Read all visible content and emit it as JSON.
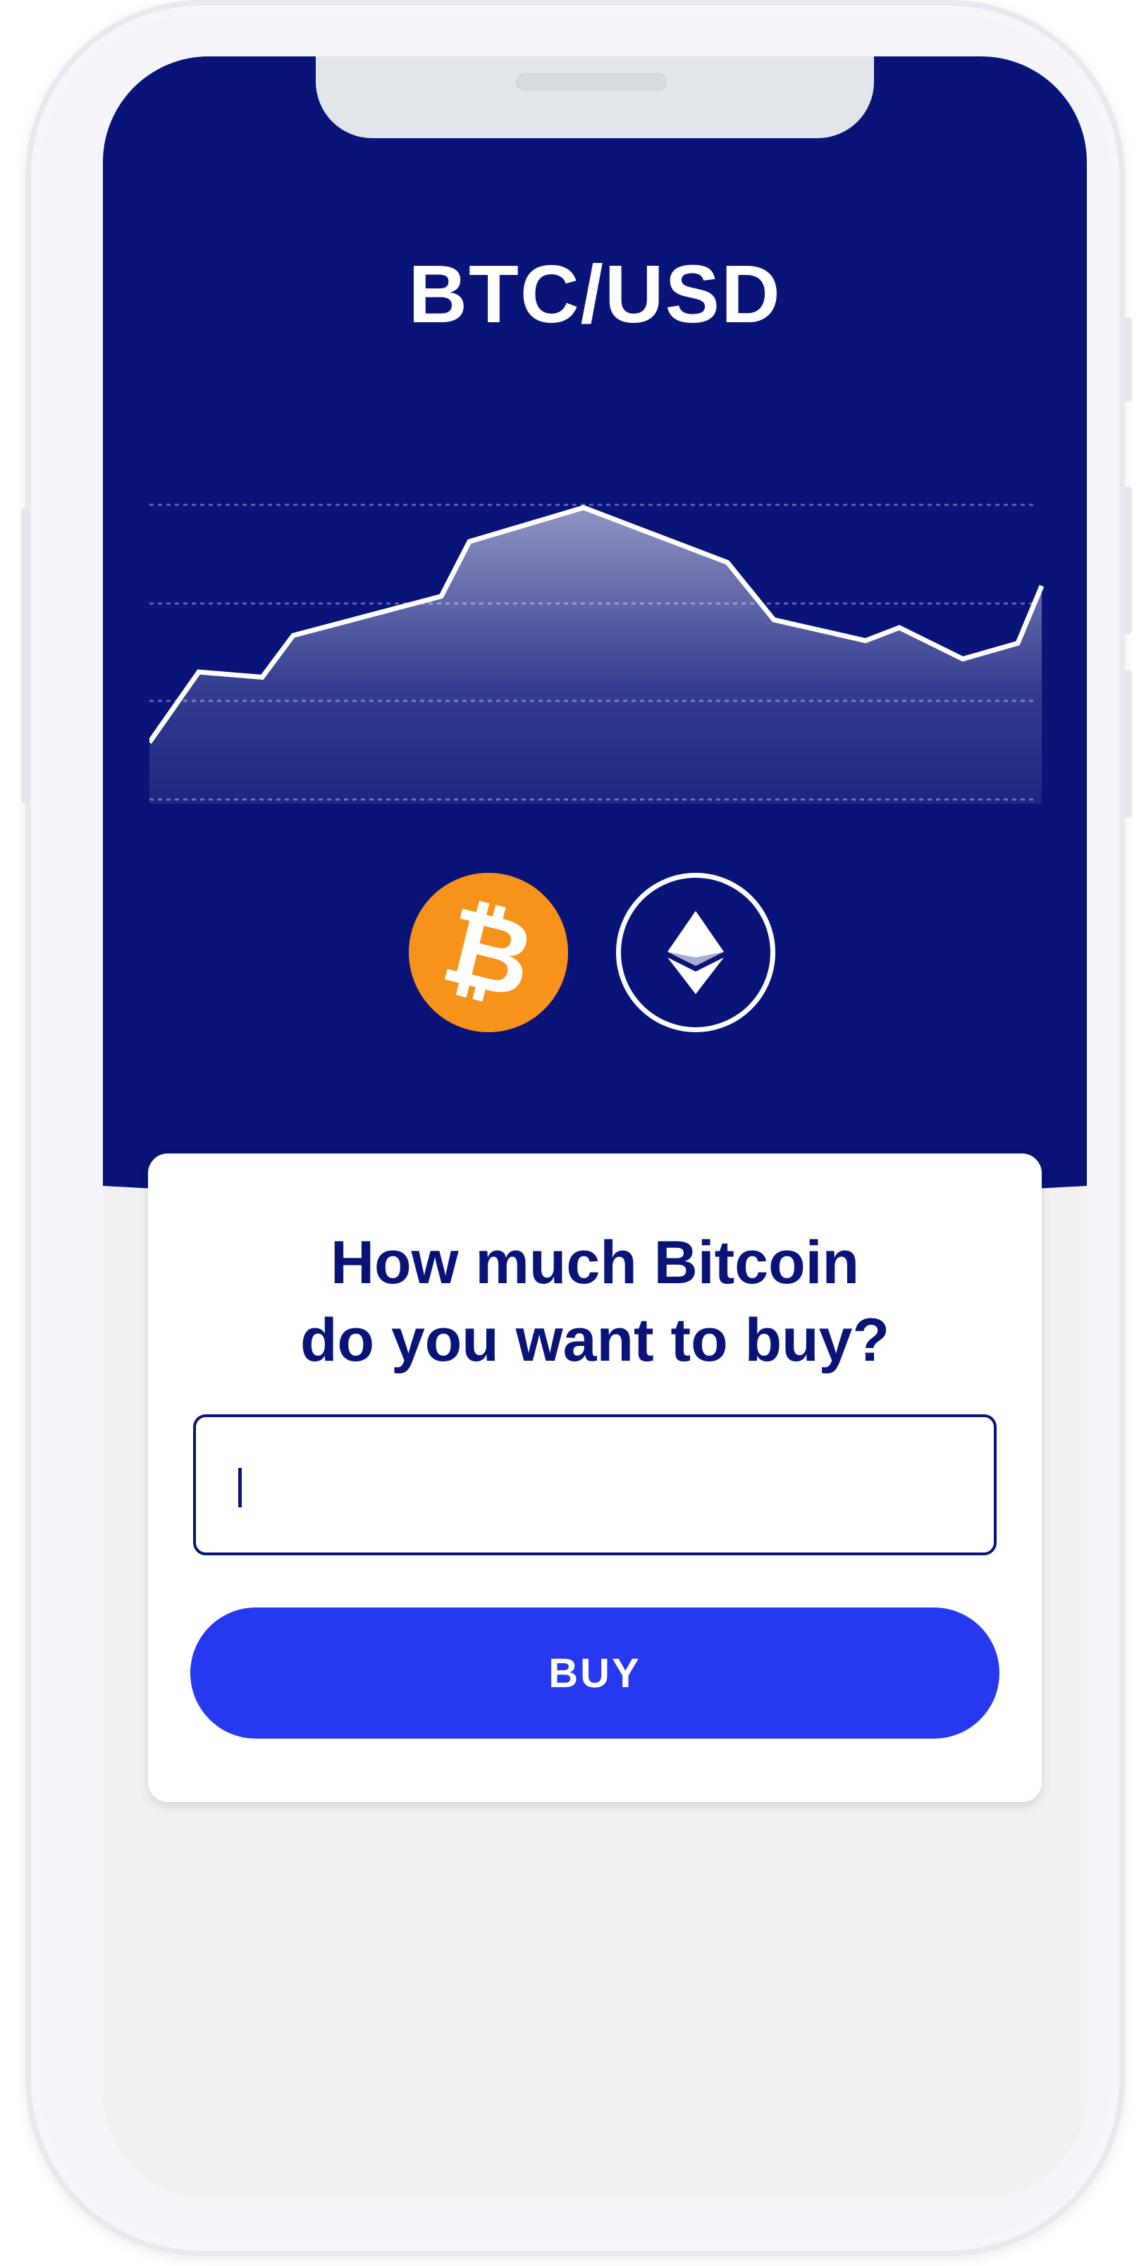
{
  "header": {
    "pair": "BTC/USD"
  },
  "chart_data": {
    "type": "area",
    "title": "",
    "grid": true,
    "values": [
      0.1,
      0.37,
      0.35,
      0.51,
      0.66,
      0.87,
      1.0,
      0.79,
      0.57,
      0.49,
      0.54,
      0.42,
      0.48,
      0.7
    ]
  },
  "coins": [
    {
      "name": "Bitcoin",
      "icon": "bitcoin-icon",
      "color": "#f7931a",
      "selected": true
    },
    {
      "name": "Ethereum",
      "icon": "ethereum-icon",
      "color": "#ffffff",
      "selected": false
    }
  ],
  "buy_card": {
    "question_line1": "How much Bitcoin",
    "question_line2": "do you want to buy?",
    "amount_value": "",
    "buy_label": "BUY"
  },
  "colors": {
    "hero_background": "#0a1378",
    "accent_button": "#2638f0",
    "bitcoin": "#f7931a"
  }
}
